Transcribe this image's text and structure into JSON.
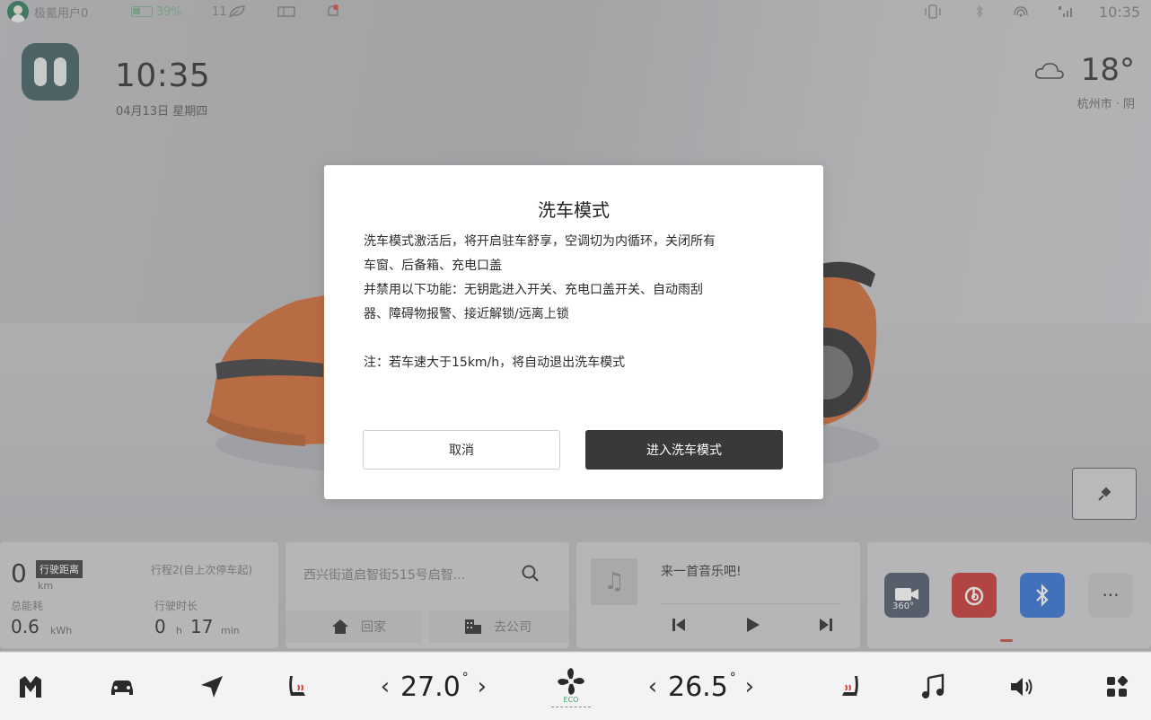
{
  "status_bar": {
    "user": "极氪用户0",
    "battery": "39%",
    "eco_count": "11",
    "time": "10:35"
  },
  "home": {
    "time": "10:35",
    "date": "04月13日 星期四"
  },
  "weather": {
    "temperature": "18°",
    "location": "杭州市 · 阴"
  },
  "trip_card": {
    "distance_value": "0",
    "distance_unit": "km",
    "distance_tag": "行驶距离",
    "trip_scope": "行程2(自上次停车起)",
    "energy_label": "总能耗",
    "energy_value": "0.6",
    "energy_unit": "kWh",
    "duration_label": "行驶时长",
    "duration_hours": "0",
    "duration_hours_unit": "h",
    "duration_minutes": "17",
    "duration_minutes_unit": "min"
  },
  "nav_card": {
    "search_text": "西兴街道启智街515号启智...",
    "home_label": "回家",
    "work_label": "去公司"
  },
  "music_card": {
    "title": "来一首音乐吧!"
  },
  "apps_card": {
    "apps": [
      {
        "name": "360-camera",
        "label": "360°",
        "color": "#4a5566"
      },
      {
        "name": "netease-music",
        "color": "#c8332e"
      },
      {
        "name": "bluetooth",
        "color": "#2f6fd2"
      }
    ],
    "more_label": "···"
  },
  "dock": {
    "driver_temp": "27.0",
    "passenger_temp": "26.5",
    "deg_symbol": "°",
    "fan_mode": "ECO"
  },
  "dialog": {
    "title": "洗车模式",
    "line1": "洗车模式激活后，将开启驻车舒享，空调切为内循环，关闭所有",
    "line2": "车窗、后备箱、充电口盖",
    "line3": "并禁用以下功能：无钥匙进入开关、充电口盖开关、自动雨刮",
    "line4": "器、障碍物报警、接近解锁/远离上锁",
    "note": "注：若车速大于15km/h，将自动退出洗车模式",
    "cancel_label": "取消",
    "confirm_label": "进入洗车模式"
  },
  "colors": {
    "confirm_button": "#393939",
    "accent_red": "#c84a3a",
    "car_orange": "#d2692e"
  }
}
